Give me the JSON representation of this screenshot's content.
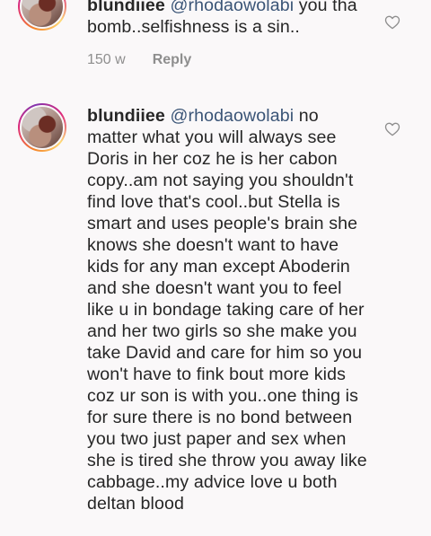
{
  "comments": [
    {
      "username": "blundiiee",
      "mention": "@rhodaowolabi",
      "text": " you tha bomb..selfishness is a sin..",
      "time": "150 w",
      "reply_label": "Reply"
    },
    {
      "username": "blundiiee",
      "mention": "@rhodaowolabi",
      "text": " no matter what you will always see Doris in her coz he is her cabon copy..am not saying you shouldn't find love that's cool..but Stella is smart and uses people's brain she knows she doesn't want to have kids for any man except Aboderin and she doesn't want you to feel like u in bondage taking care of her and her two girls so she make you take David and care for him so you won't have to fink bout more kids coz ur son is with you..one thing is for sure there is no bond between you two just paper and sex when she is tired she throw you away like cabbage..my advice love u both deltan blood"
    }
  ],
  "icons": {
    "like": "heart-outline-icon",
    "avatar": "user-avatar"
  },
  "colors": {
    "mention": "#3b5577",
    "meta": "#8e8e8e",
    "text": "#262626"
  }
}
